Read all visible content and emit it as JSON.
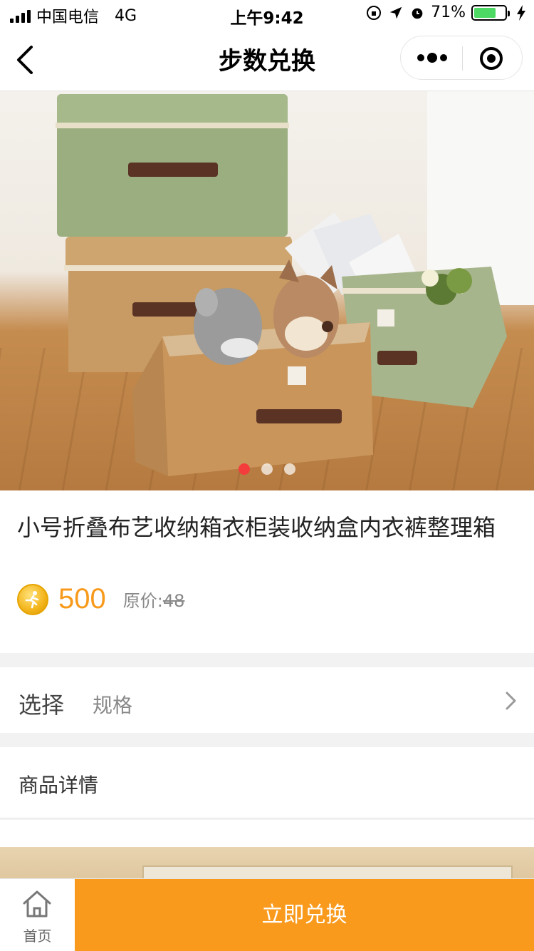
{
  "status_bar": {
    "carrier": "中国电信",
    "network": "4G",
    "time": "上午9:42",
    "battery": "71%",
    "battery_level": 0.71,
    "battery_color": "#4cd964"
  },
  "nav": {
    "title": "步数兑换",
    "back_icon": "chevron-left-icon",
    "more_icon": "more-dots-icon",
    "close_icon": "target-icon"
  },
  "gallery": {
    "slide_count": 3,
    "active_index": 0,
    "active_color": "#f43c3c"
  },
  "product": {
    "title": "小号折叠布艺收纳箱衣柜装收纳盒内衣裤整理箱",
    "price": "500",
    "original_label": "原价:",
    "original_price": "48",
    "price_color": "#f79a1c",
    "coin_icon": "step-coin-icon"
  },
  "select_row": {
    "label": "选择",
    "value": "规格"
  },
  "detail_row": {
    "label": "商品详情"
  },
  "bottom_bar": {
    "home_label": "首页",
    "exchange_label": "立即兑换",
    "button_color": "#f99a1c"
  }
}
